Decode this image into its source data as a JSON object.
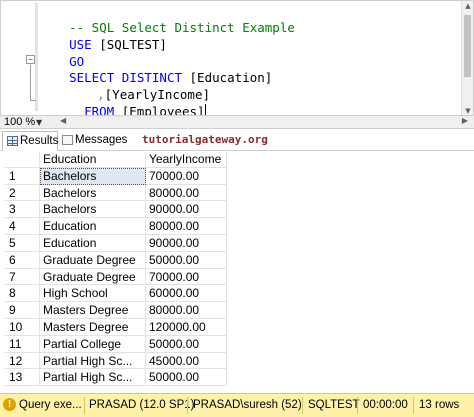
{
  "editor": {
    "line1": {
      "comment": "-- SQL Select Distinct Example"
    },
    "line2": {
      "kw": "USE",
      "rest": " [SQLTEST]"
    },
    "line3": {
      "kw": "GO"
    },
    "line4": {
      "kw": "SELECT DISTINCT",
      "rest": " [Education]"
    },
    "line5": {
      "sep": ",",
      "rest": "[YearlyIncome]"
    },
    "line6": {
      "kw": "FROM",
      "rest": " [Employees]"
    },
    "collapse_glyph": "−"
  },
  "zoom": {
    "value": "100 %"
  },
  "tabs": {
    "results": "Results",
    "messages": "Messages",
    "watermark": "tutorialgateway.org"
  },
  "grid": {
    "columns": [
      "",
      "Education",
      "YearlyIncome"
    ],
    "rows": [
      {
        "n": "1",
        "education": "Bachelors",
        "income": "70000.00"
      },
      {
        "n": "2",
        "education": "Bachelors",
        "income": "80000.00"
      },
      {
        "n": "3",
        "education": "Bachelors",
        "income": "90000.00"
      },
      {
        "n": "4",
        "education": "Education",
        "income": "80000.00"
      },
      {
        "n": "5",
        "education": "Education",
        "income": "90000.00"
      },
      {
        "n": "6",
        "education": "Graduate Degree",
        "income": "50000.00"
      },
      {
        "n": "7",
        "education": "Graduate Degree",
        "income": "70000.00"
      },
      {
        "n": "8",
        "education": "High School",
        "income": "60000.00"
      },
      {
        "n": "9",
        "education": "Masters Degree",
        "income": "80000.00"
      },
      {
        "n": "10",
        "education": "Masters Degree",
        "income": "120000.00"
      },
      {
        "n": "11",
        "education": "Partial College",
        "income": "50000.00"
      },
      {
        "n": "12",
        "education": "Partial High Sc...",
        "income": "45000.00"
      },
      {
        "n": "13",
        "education": "Partial High Sc...",
        "income": "50000.00"
      }
    ]
  },
  "status": {
    "query": "Query exe...",
    "server": "PRASAD (12.0 SP1)",
    "user": "PRASAD\\suresh (52)",
    "database": "SQLTEST",
    "time": "00:00:00",
    "rows": "13 rows",
    "warn_glyph": "!"
  },
  "colors": {
    "status_bg": "#fff2a8",
    "keyword": "#0000ff",
    "comment": "#008000",
    "watermark": "#8a2a2a"
  }
}
